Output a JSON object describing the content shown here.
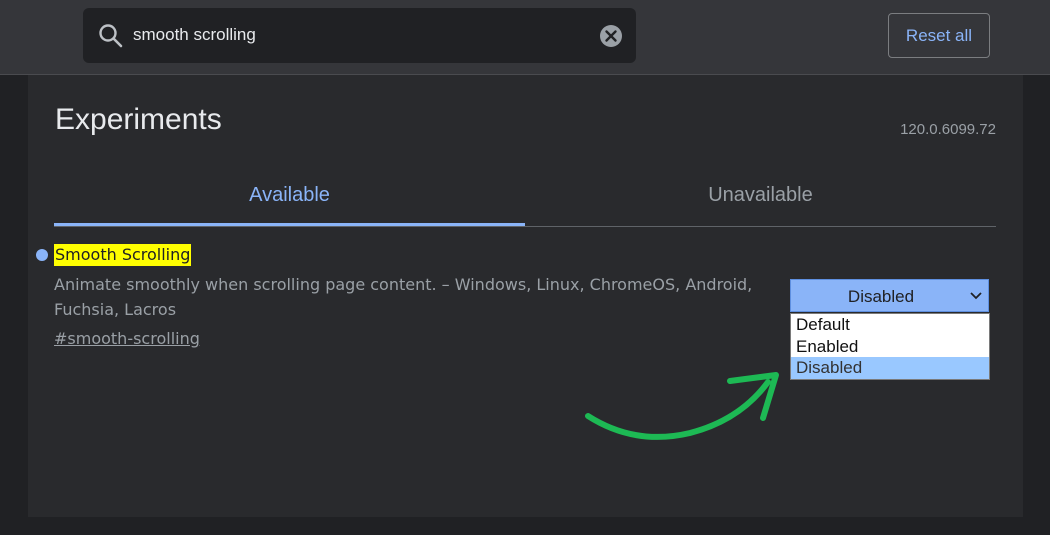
{
  "header": {
    "search": {
      "value": "smooth scrolling",
      "placeholder": "Search flags"
    },
    "reset_label": "Reset all"
  },
  "page": {
    "title": "Experiments",
    "version": "120.0.6099.72",
    "tabs": [
      {
        "label": "Available",
        "active": true
      },
      {
        "label": "Unavailable",
        "active": false
      }
    ]
  },
  "experiment": {
    "title": "Smooth Scrolling",
    "description": "Animate smoothly when scrolling page content. – Windows, Linux, ChromeOS, Android, Fuchsia, Lacros",
    "link": "#smooth-scrolling",
    "select": {
      "value": "Disabled",
      "options": [
        "Default",
        "Enabled",
        "Disabled"
      ],
      "selected_index": 2
    }
  },
  "colors": {
    "accent": "#8ab4f8",
    "highlight": "#ffff00",
    "annotation_arrow": "#1db954"
  },
  "icons": {
    "search": "search-icon",
    "clear": "clear-icon",
    "chevron": "chevron-down-icon",
    "arrow": "curved-arrow-icon"
  }
}
